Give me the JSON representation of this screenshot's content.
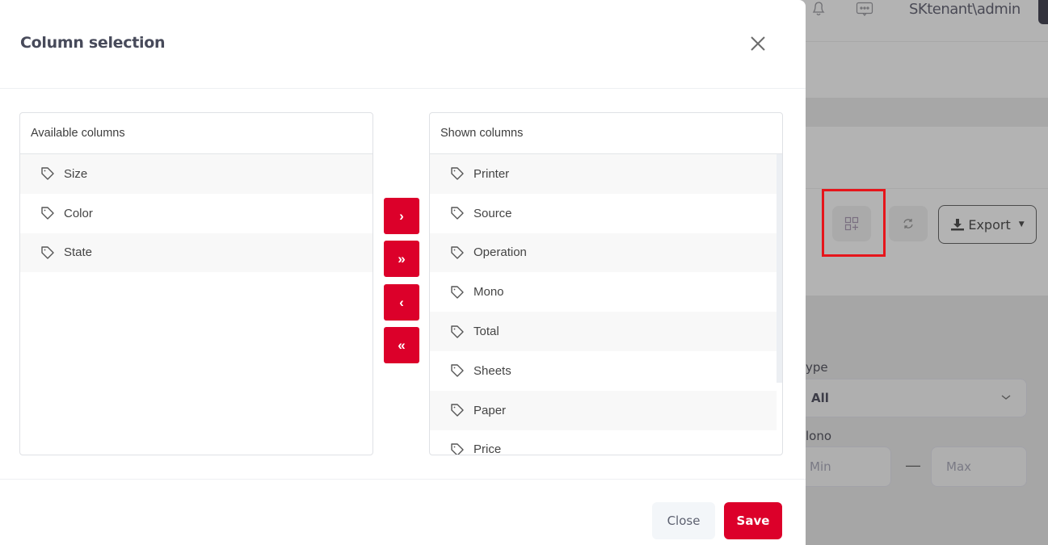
{
  "background": {
    "user_label": "SKtenant\\admin",
    "export_label": "Export",
    "filters": {
      "type_label": "ype",
      "type_value": "All",
      "mono_label": "lono",
      "min_placeholder": "Min",
      "max_placeholder": "Max",
      "range_separator": "—"
    },
    "icons": [
      "bell-icon",
      "chat-icon",
      "column-selection-icon",
      "refresh-icon",
      "download-icon"
    ],
    "highlight_color": "#e6151b"
  },
  "modal": {
    "title": "Column selection",
    "available": {
      "header": "Available columns",
      "items": [
        "Size",
        "Color",
        "State"
      ]
    },
    "shown": {
      "header": "Shown columns",
      "items": [
        "Printer",
        "Source",
        "Operation",
        "Mono",
        "Total",
        "Sheets",
        "Paper",
        "Price"
      ]
    },
    "move_buttons": {
      "move_right": "›",
      "move_all_right": "»",
      "move_left": "‹",
      "move_all_left": "«"
    },
    "footer": {
      "close_label": "Close",
      "save_label": "Save"
    },
    "accent_color": "#dc002a"
  }
}
